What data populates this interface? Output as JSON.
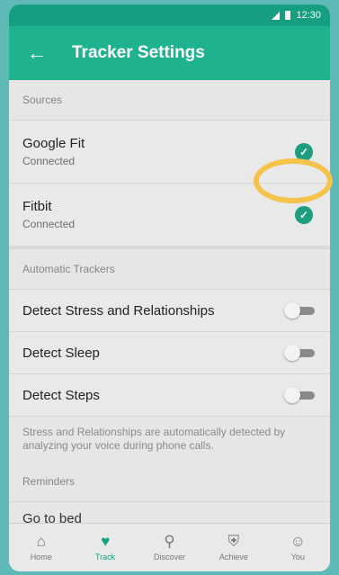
{
  "status_bar": {
    "time": "12:30"
  },
  "app_bar": {
    "title": "Tracker Settings",
    "back_icon": "arrow-left-icon"
  },
  "sources": {
    "header": "Sources",
    "items": [
      {
        "name": "Google Fit",
        "status": "Connected",
        "checked": true
      },
      {
        "name": "Fitbit",
        "status": "Connected",
        "checked": true,
        "highlighted": true
      }
    ]
  },
  "automatic_trackers": {
    "header": "Automatic Trackers",
    "items": [
      {
        "name": "Detect Stress and Relationships",
        "enabled": false
      },
      {
        "name": "Detect Sleep",
        "enabled": false
      },
      {
        "name": "Detect Steps",
        "enabled": false
      }
    ],
    "note": "Stress and Relationships are automatically detected by analyzing your voice during phone calls."
  },
  "reminders": {
    "header": "Reminders",
    "first_item_partial": "Go to bed"
  },
  "bottom_nav": {
    "items": [
      {
        "label": "Home",
        "icon": "home-icon",
        "active": false
      },
      {
        "label": "Track",
        "icon": "heart-icon",
        "active": true
      },
      {
        "label": "Discover",
        "icon": "search-icon",
        "active": false
      },
      {
        "label": "Achieve",
        "icon": "shield-icon",
        "active": false
      },
      {
        "label": "You",
        "icon": "person-icon",
        "active": false
      }
    ]
  },
  "colors": {
    "appbar": "#1fb28f",
    "statusbar": "#169e80",
    "accent": "#1d9e80",
    "highlight_ring": "#f5c24a",
    "frame_background": "#5fbab7"
  }
}
